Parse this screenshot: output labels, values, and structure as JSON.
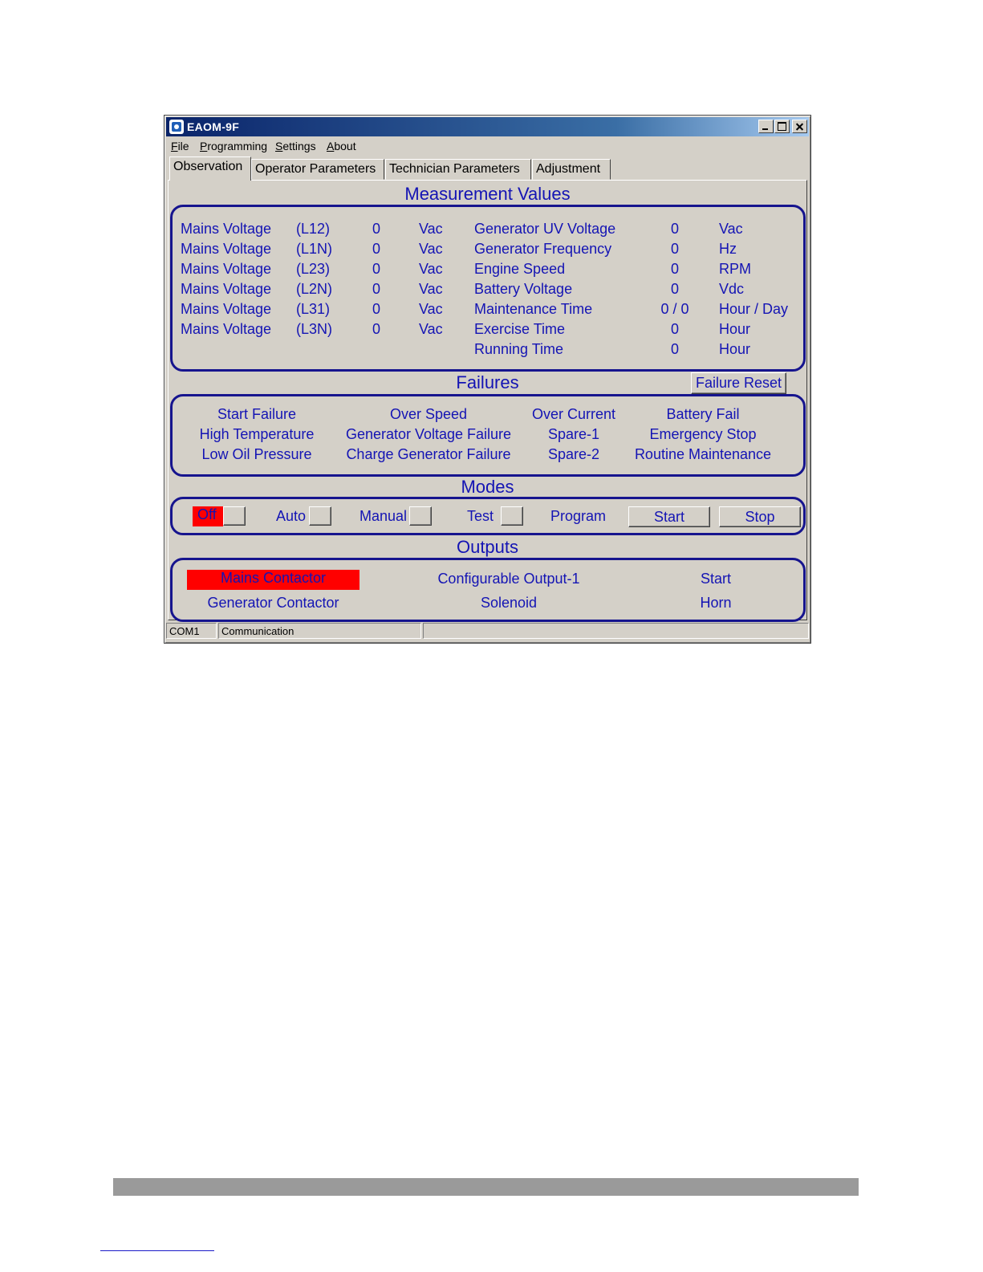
{
  "window": {
    "title": "EAOM-9F"
  },
  "menu": [
    {
      "mnemonic": "F",
      "rest": "ile"
    },
    {
      "mnemonic": "P",
      "rest": "rogramming"
    },
    {
      "mnemonic": "S",
      "rest": "ettings"
    },
    {
      "mnemonic": "A",
      "rest": "bout"
    }
  ],
  "tabs": [
    "Observation",
    "Operator Parameters",
    "Technician Parameters",
    "Adjustment"
  ],
  "measurement": {
    "title": "Measurement Values",
    "left": [
      {
        "label": "Mains Voltage",
        "phase": "(L12)",
        "value": "0",
        "unit": "Vac"
      },
      {
        "label": "Mains Voltage",
        "phase": "(L1N)",
        "value": "0",
        "unit": "Vac"
      },
      {
        "label": "Mains Voltage",
        "phase": "(L23)",
        "value": "0",
        "unit": "Vac"
      },
      {
        "label": "Mains Voltage",
        "phase": "(L2N)",
        "value": "0",
        "unit": "Vac"
      },
      {
        "label": "Mains Voltage",
        "phase": "(L31)",
        "value": "0",
        "unit": "Vac"
      },
      {
        "label": "Mains Voltage",
        "phase": "(L3N)",
        "value": "0",
        "unit": "Vac"
      }
    ],
    "right": [
      {
        "label": "Generator UV Voltage",
        "value": "0",
        "unit": "Vac"
      },
      {
        "label": "Generator Frequency",
        "value": "0",
        "unit": "Hz"
      },
      {
        "label": "Engine Speed",
        "value": "0",
        "unit": "RPM"
      },
      {
        "label": "Battery Voltage",
        "value": "0",
        "unit": "Vdc"
      },
      {
        "label": "Maintenance Time",
        "value": "0 / 0",
        "unit": "Hour / Day"
      },
      {
        "label": "Exercise Time",
        "value": "0",
        "unit": "Hour"
      },
      {
        "label": "Running Time",
        "value": "0",
        "unit": "Hour"
      }
    ]
  },
  "failures": {
    "title": "Failures",
    "reset_label": "Failure Reset",
    "col1": [
      "Start Failure",
      "High Temperature",
      "Low Oil Pressure"
    ],
    "col2": [
      "Over Speed",
      "Generator Voltage Failure",
      "Charge Generator Failure"
    ],
    "col3": [
      "Over Current",
      "Spare-1",
      "Spare-2"
    ],
    "col4": [
      "Battery Fail",
      "Emergency Stop",
      "Routine Maintenance"
    ]
  },
  "modes": {
    "title": "Modes",
    "off": "Off",
    "auto": "Auto",
    "manual": "Manual",
    "test": "Test",
    "program": "Program",
    "start": "Start",
    "stop": "Stop",
    "active_color": "#ff0000"
  },
  "outputs": {
    "title": "Outputs",
    "items": [
      "Mains Contactor",
      "Configurable Output-1",
      "Start",
      "Generator Contactor",
      "Solenoid",
      "Horn"
    ],
    "active_color": "#ff0000"
  },
  "status": {
    "port": "COM1",
    "state": "Communication",
    "extra": ""
  },
  "colors": {
    "text_blue": "#1414b4",
    "frame_blue": "#16148e",
    "window_bg": "#d4d0c8"
  }
}
